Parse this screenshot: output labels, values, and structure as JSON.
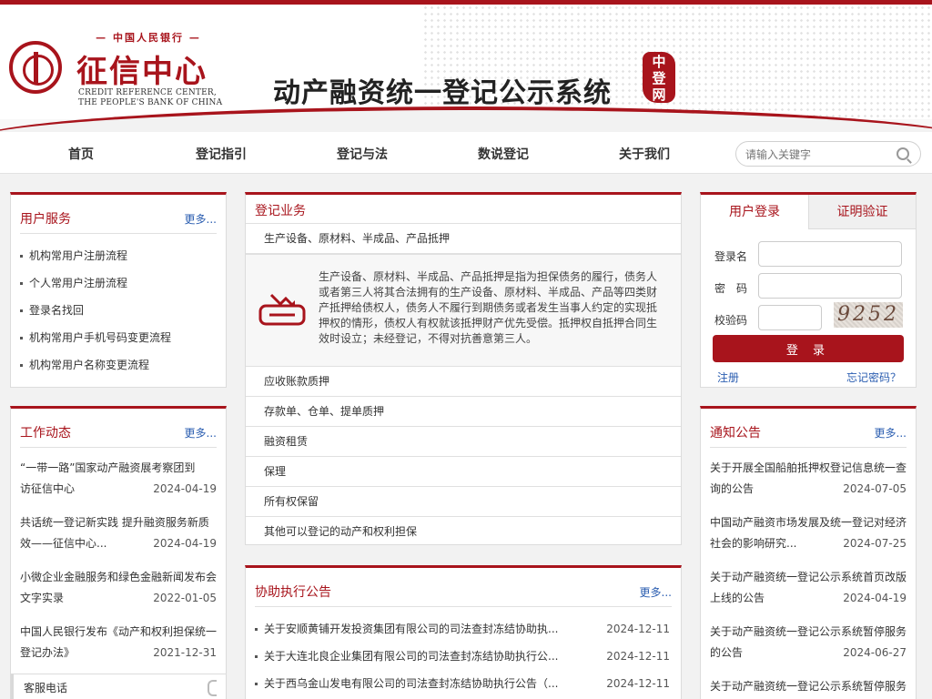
{
  "header": {
    "org_top": "中国人民银行",
    "org_main": "征信中心",
    "org_en_1": "CREDIT REFERENCE CENTER,",
    "org_en_2": "THE PEOPLE'S BANK OF CHINA",
    "system_title": "动产融资统一登记公示系统",
    "seal_text": "中登网"
  },
  "nav": {
    "items": [
      "首页",
      "登记指引",
      "登记与法",
      "数说登记",
      "关于我们"
    ],
    "search_placeholder": "请输入关键字"
  },
  "user_service": {
    "title": "用户服务",
    "more": "更多...",
    "items": [
      "机构常用户注册流程",
      "个人常用户注册流程",
      "登录名找回",
      "机构常用户手机号码变更流程",
      "机构常用户名称变更流程"
    ]
  },
  "work_news": {
    "title": "工作动态",
    "more": "更多...",
    "items": [
      {
        "line1": "“一带一路”国家动产融资展考察团到",
        "line2": "访征信中心",
        "date": "2024-04-19"
      },
      {
        "line1": "共话统一登记新实践 提升融资服务新质",
        "line2": "效——征信中心...",
        "date": "2024-04-19"
      },
      {
        "line1": "小微企业金融服务和绿色金融新闻发布会",
        "line2": "文字实录",
        "date": "2022-01-05"
      },
      {
        "line1": "中国人民银行发布《动产和权利担保统一",
        "line2": "登记办法》",
        "date": "2021-12-31"
      }
    ]
  },
  "customer_service": {
    "label": "客服电话"
  },
  "registration": {
    "title": "登记业务",
    "expanded_item": "生产设备、原材料、半成品、产品抵押",
    "expanded_desc": "生产设备、原材料、半成品、产品抵押是指为担保债务的履行，债务人或者第三人将其合法拥有的生产设备、原材料、半成品、产品等四类财产抵押给债权人，债务人不履行到期债务或者发生当事人约定的实现抵押权的情形，债权人有权就该抵押财产优先受偿。抵押权自抵押合同生效时设立；未经登记，不得对抗善意第三人。",
    "items": [
      "应收账款质押",
      "存款单、仓单、提单质押",
      "融资租赁",
      "保理",
      "所有权保留",
      "其他可以登记的动产和权利担保"
    ]
  },
  "assist": {
    "title": "协助执行公告",
    "more": "更多...",
    "items": [
      {
        "text": "关于安顺黄铺开发投资集团有限公司的司法查封冻结协助执...",
        "date": "2024-12-11"
      },
      {
        "text": "关于大连北良企业集团有限公司的司法查封冻结协助执行公...",
        "date": "2024-12-11"
      },
      {
        "text": "关于西乌金山发电有限公司的司法查封冻结协助执行公告（...",
        "date": "2024-12-11"
      }
    ]
  },
  "login": {
    "tab_login": "用户登录",
    "tab_verify": "证明验证",
    "username_label": "登录名",
    "password_label": "密　码",
    "captcha_label": "校验码",
    "captcha_text": "9252",
    "submit": "登 录",
    "register": "注册",
    "forgot": "忘记密码？"
  },
  "notices": {
    "title": "通知公告",
    "more": "更多...",
    "items": [
      {
        "line1": "关于开展全国船舶抵押权登记信息统一查",
        "line2": "询的公告",
        "date": "2024-07-05"
      },
      {
        "line1": "中国动产融资市场发展及统一登记对经济",
        "line2": "社会的影响研究...",
        "date": "2024-07-25"
      },
      {
        "line1": "关于动产融资统一登记公示系统首页改版",
        "line2": "上线的公告",
        "date": "2024-04-19"
      },
      {
        "line1": "关于动产融资统一登记公示系统暂停服务",
        "line2": "的公告",
        "date": "2024-06-27"
      },
      {
        "line1": "关于动产融资统一登记公示系统暂停服务",
        "line2": "",
        "date": ""
      }
    ]
  },
  "colors": {
    "brand": "#a8141c",
    "link": "#2a5db0"
  }
}
